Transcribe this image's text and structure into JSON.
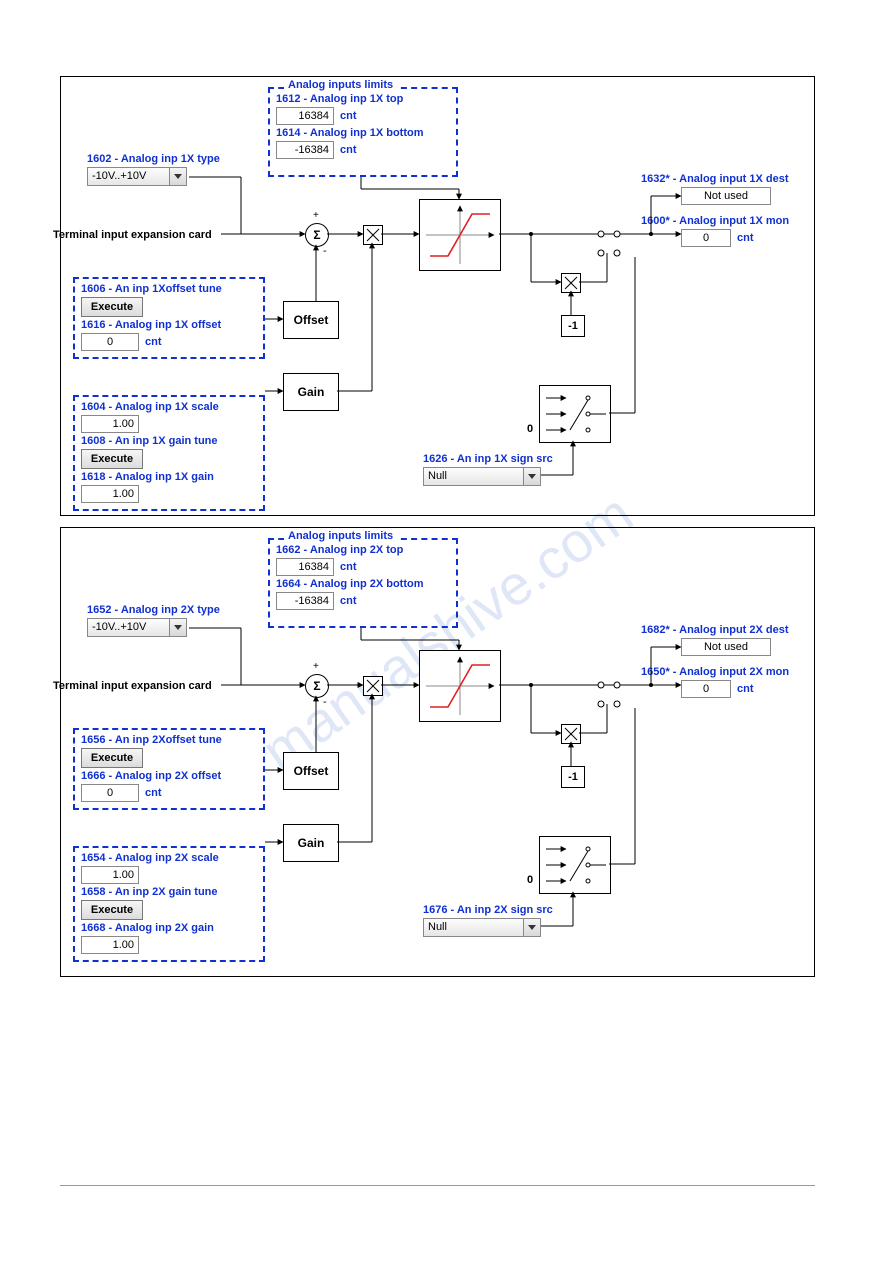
{
  "watermark": "manualshive.com",
  "panels": [
    {
      "id": "1X",
      "limits_title": "Analog inputs limits",
      "terminal_label": "Terminal input expansion card",
      "type": {
        "label": "1602 - Analog inp 1X type",
        "value": "-10V..+10V"
      },
      "top": {
        "label": "1612 - Analog inp 1X top",
        "value": "16384",
        "unit": "cnt"
      },
      "bottom": {
        "label": "1614 - Analog inp 1X bottom",
        "value": "-16384",
        "unit": "cnt"
      },
      "offset_tune": {
        "label": "1606 - An inp 1Xoffset tune",
        "button": "Execute"
      },
      "offset": {
        "label": "1616 - Analog inp 1X offset",
        "value": "0",
        "unit": "cnt"
      },
      "scale": {
        "label": "1604 - Analog inp 1X scale",
        "value": "1.00"
      },
      "gain_tune": {
        "label": "1608 - An inp 1X gain tune",
        "button": "Execute"
      },
      "gain": {
        "label": "1618 - Analog inp 1X gain",
        "value": "1.00"
      },
      "sign_src": {
        "label": "1626 - An inp 1X sign src",
        "value": "Null"
      },
      "dest": {
        "label": "1632* - Analog input 1X dest",
        "value": "Not used"
      },
      "mon": {
        "label": "1600* - Analog input 1X mon",
        "value": "0",
        "unit": "cnt"
      },
      "blk_offset": "Offset",
      "blk_gain": "Gain",
      "minus_one": "-1",
      "zero": "0"
    },
    {
      "id": "2X",
      "limits_title": "Analog inputs limits",
      "terminal_label": "Terminal input expansion card",
      "type": {
        "label": "1652 - Analog inp 2X type",
        "value": "-10V..+10V"
      },
      "top": {
        "label": "1662 - Analog inp 2X top",
        "value": "16384",
        "unit": "cnt"
      },
      "bottom": {
        "label": "1664 - Analog inp 2X bottom",
        "value": "-16384",
        "unit": "cnt"
      },
      "offset_tune": {
        "label": "1656 - An inp 2Xoffset tune",
        "button": "Execute"
      },
      "offset": {
        "label": "1666 - Analog inp 2X offset",
        "value": "0",
        "unit": "cnt"
      },
      "scale": {
        "label": "1654 - Analog inp 2X scale",
        "value": "1.00"
      },
      "gain_tune": {
        "label": "1658 - An inp 2X gain tune",
        "button": "Execute"
      },
      "gain": {
        "label": "1668 - Analog inp 2X gain",
        "value": "1.00"
      },
      "sign_src": {
        "label": "1676 - An inp 2X sign src",
        "value": "Null"
      },
      "dest": {
        "label": "1682* - Analog input 2X dest",
        "value": "Not used"
      },
      "mon": {
        "label": "1650* - Analog input 2X mon",
        "value": "0",
        "unit": "cnt"
      },
      "blk_offset": "Offset",
      "blk_gain": "Gain",
      "minus_one": "-1",
      "zero": "0"
    }
  ]
}
